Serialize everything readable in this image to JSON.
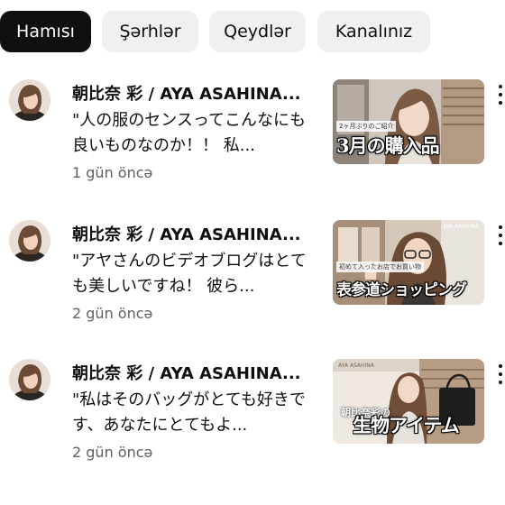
{
  "chips": [
    {
      "label": "Hamısı",
      "active": true
    },
    {
      "label": "Şərhlər",
      "active": false
    },
    {
      "label": "Qeydlər",
      "active": false
    },
    {
      "label": "Kanalınız",
      "active": false
    }
  ],
  "items": [
    {
      "title": "朝比奈 彩 / AYA ASAHINA...",
      "comment": "\"人の服のセンスってこんなにも良いものなのか！！ 私...",
      "time": "1 gün öncə",
      "thumb_caption": "3月の購入品",
      "thumb_sub": "2ヶ月ぶりのご紹介",
      "avatar_icon": "channel-avatar",
      "more_icon": "more-vertical-icon"
    },
    {
      "title": "朝比奈 彩 / AYA ASAHINA...",
      "comment": "\"アヤさんのビデオブログはとても美しいですね！ 彼ら...",
      "time": "2 gün öncə",
      "thumb_caption": "表参道ショッピング",
      "thumb_sub": "初めて入ったお店でお買い物",
      "thumb_brand": "AYA ASAHINA",
      "avatar_icon": "channel-avatar",
      "more_icon": "more-vertical-icon"
    },
    {
      "title": "朝比奈 彩 / AYA ASAHINA...",
      "comment": "\"私はそのバッグがとても好きです、あなたにとてもよ...",
      "time": "2 gün öncə",
      "thumb_caption": "生物アイテム",
      "thumb_sub": "朝比奈彩の",
      "thumb_brand": "AYA ASAHINA",
      "avatar_icon": "channel-avatar",
      "more_icon": "more-vertical-icon"
    }
  ],
  "colors": {
    "chip_active_bg": "#0f0f0f",
    "chip_bg": "#f0f0f0",
    "secondary_text": "#606060"
  }
}
